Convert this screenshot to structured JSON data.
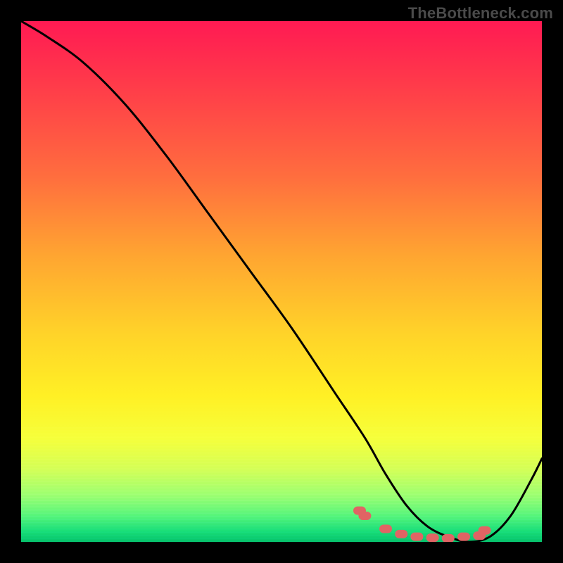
{
  "watermark": "TheBottleneck.com",
  "chart_data": {
    "type": "line",
    "title": "",
    "xlabel": "",
    "ylabel": "",
    "xlim": [
      0,
      100
    ],
    "ylim": [
      0,
      100
    ],
    "series": [
      {
        "name": "bottleneck_curve",
        "x": [
          0,
          5,
          12,
          20,
          28,
          36,
          44,
          52,
          60,
          66,
          70,
          74,
          78,
          82,
          86,
          90,
          94,
          98,
          100
        ],
        "values": [
          100,
          97,
          92,
          84,
          74,
          63,
          52,
          41,
          29,
          20,
          13,
          7,
          3,
          1,
          0,
          1,
          5,
          12,
          16
        ]
      }
    ],
    "scatter": {
      "name": "highlight_points",
      "x": [
        65,
        66,
        70,
        73,
        76,
        79,
        82,
        85,
        88,
        89
      ],
      "values": [
        6,
        5,
        2.5,
        1.5,
        1,
        0.8,
        0.7,
        1,
        1.2,
        2.2
      ]
    },
    "gradient_stops": [
      {
        "pos": 0,
        "color": "#ff1a53"
      },
      {
        "pos": 12,
        "color": "#ff3a4a"
      },
      {
        "pos": 30,
        "color": "#ff6e3e"
      },
      {
        "pos": 45,
        "color": "#ffa531"
      },
      {
        "pos": 60,
        "color": "#ffd329"
      },
      {
        "pos": 72,
        "color": "#fff025"
      },
      {
        "pos": 80,
        "color": "#f6ff3a"
      },
      {
        "pos": 86,
        "color": "#d4ff56"
      },
      {
        "pos": 91,
        "color": "#9cff70"
      },
      {
        "pos": 95,
        "color": "#55f57a"
      },
      {
        "pos": 98,
        "color": "#18dd77"
      },
      {
        "pos": 100,
        "color": "#06c26a"
      }
    ]
  }
}
